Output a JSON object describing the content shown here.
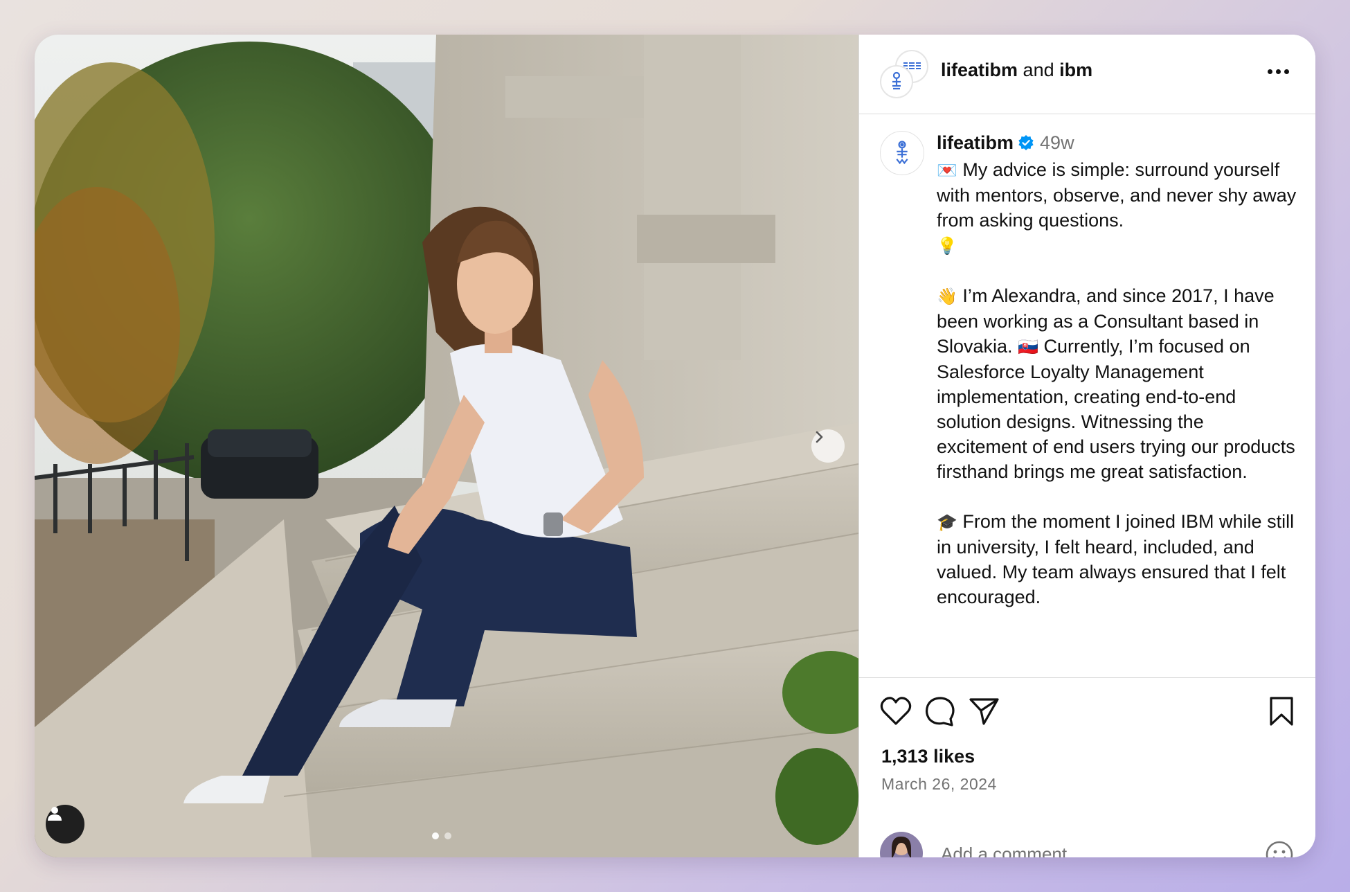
{
  "header": {
    "author": "lifeatibm",
    "joiner": "and",
    "coauthor": "ibm",
    "more_icon": "more-horizontal-icon",
    "avatar_text": "IBM"
  },
  "caption": {
    "username": "lifeatibm",
    "verified_icon": "verified-badge-icon",
    "time_ago": "49w",
    "paragraphs": [
      {
        "emoji": "💌",
        "text": "My advice is simple: surround yourself with mentors, observe, and never shy away from asking questions.",
        "trail_emoji": "💡"
      },
      {
        "emoji": "👋",
        "text": "I’m Alexandra, and since 2017, I have been working as a Consultant based in Slovakia.",
        "mid_emoji": "🇸🇰",
        "text2": "Currently, I’m focused on Salesforce Loyalty Management implementation, creating end-to-end solution designs. Witnessing the excitement of end users trying our products firsthand brings me great satisfaction."
      },
      {
        "emoji": "🎓",
        "text": "From the moment I joined IBM while still in university, I felt heard, included, and valued. My team always ensured that I felt encouraged."
      }
    ]
  },
  "actions": {
    "like_icon": "heart-icon",
    "comment_icon": "comment-icon",
    "share_icon": "send-icon",
    "save_icon": "bookmark-icon",
    "likes": "1,313 likes",
    "date": "March 26, 2024"
  },
  "comment": {
    "placeholder": "Add a comment...",
    "emoji_icon": "smiley-icon"
  },
  "media": {
    "next_icon": "chevron-right-icon",
    "tag_icon": "user-tag-icon",
    "slides_total": 2,
    "active_slide": 1
  },
  "colors": {
    "verified": "#0095f6",
    "text": "#111111",
    "muted": "#737373",
    "divider": "#dbdbdb"
  }
}
